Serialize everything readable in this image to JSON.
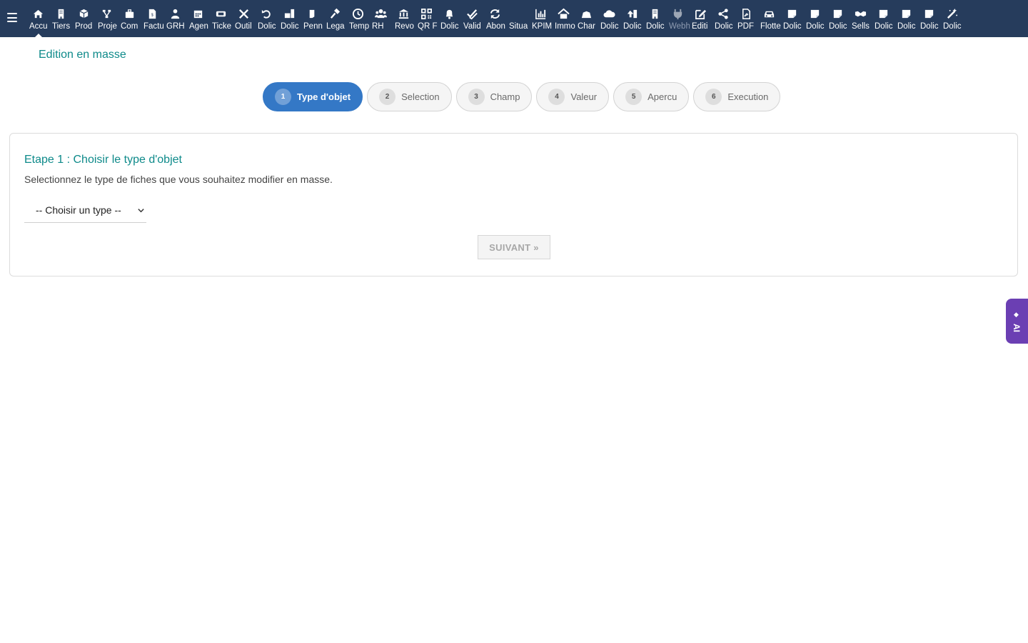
{
  "app": {
    "menu_icon": "hamburger-icon"
  },
  "top_menu": [
    {
      "label": "Accu",
      "icon": "home-icon",
      "active": true
    },
    {
      "label": "Tiers",
      "icon": "building-icon"
    },
    {
      "label": "Prod",
      "icon": "cube-icon"
    },
    {
      "label": "Proje",
      "icon": "sitemap-icon"
    },
    {
      "label": "Com",
      "icon": "suitcase-icon"
    },
    {
      "label": "Factu",
      "icon": "invoice-icon"
    },
    {
      "label": "GRH",
      "icon": "user-tie-icon"
    },
    {
      "label": "Agen",
      "icon": "calendar-icon"
    },
    {
      "label": "Ticke",
      "icon": "ticket-icon"
    },
    {
      "label": "Outil",
      "icon": "tools-icon"
    },
    {
      "label": "Dolic",
      "icon": "undo-icon"
    },
    {
      "label": "Dolic",
      "icon": "briefcase-doc-icon"
    },
    {
      "label": "Penn",
      "icon": "page-icon"
    },
    {
      "label": "Lega",
      "icon": "gavel-icon"
    },
    {
      "label": "Temp",
      "icon": "clock-icon"
    },
    {
      "label": "RH",
      "icon": "users-icon"
    },
    {
      "label": "Revo",
      "icon": "bank-icon"
    },
    {
      "label": "QR F",
      "icon": "qrcode-icon"
    },
    {
      "label": "Dolic",
      "icon": "bell-icon"
    },
    {
      "label": "Valid",
      "icon": "double-check-icon"
    },
    {
      "label": "Abon",
      "icon": "refresh-icon"
    },
    {
      "label": "Situa",
      "icon": "blank-icon"
    },
    {
      "label": "KPIM",
      "icon": "bar-chart-icon"
    },
    {
      "label": "Immo",
      "icon": "house-icon"
    },
    {
      "label": "Char",
      "icon": "pile-icon"
    },
    {
      "label": "Dolic",
      "icon": "cloud-icon"
    },
    {
      "label": "Dolic",
      "icon": "upload-icon"
    },
    {
      "label": "Dolic",
      "icon": "building-icon"
    },
    {
      "label": "Webh",
      "icon": "plug-icon",
      "dim": true
    },
    {
      "label": "Editi",
      "icon": "edit-icon"
    },
    {
      "label": "Dolic",
      "icon": "share-icon"
    },
    {
      "label": "PDF",
      "icon": "pdf-icon"
    },
    {
      "label": "Flotte",
      "icon": "car-icon"
    },
    {
      "label": "Dolic",
      "icon": "note-icon"
    },
    {
      "label": "Dolic",
      "icon": "note-icon"
    },
    {
      "label": "Dolic",
      "icon": "note-icon"
    },
    {
      "label": "Sells",
      "icon": "handshake-icon"
    },
    {
      "label": "Dolic",
      "icon": "note-icon"
    },
    {
      "label": "Dolic",
      "icon": "note-icon"
    },
    {
      "label": "Dolic",
      "icon": "note-icon"
    },
    {
      "label": "Dolic",
      "icon": "magic-icon"
    }
  ],
  "page": {
    "title": "Edition en masse"
  },
  "steps": [
    {
      "number": "1",
      "label": "Type d'objet",
      "active": true
    },
    {
      "number": "2",
      "label": "Selection"
    },
    {
      "number": "3",
      "label": "Champ"
    },
    {
      "number": "4",
      "label": "Valeur"
    },
    {
      "number": "5",
      "label": "Apercu"
    },
    {
      "number": "6",
      "label": "Execution"
    }
  ],
  "card": {
    "title": "Etape 1 : Choisir le type d'objet",
    "description": "Selectionnez le type de fiches que vous souhaitez modifier en masse.",
    "select_value": "-- Choisir un type --",
    "next_label": "SUIVANT »"
  },
  "ai_tab": {
    "label": "AI",
    "icon": "sparkle-icon"
  },
  "colors": {
    "topbar": "#263c5c",
    "accent_teal": "#0e8a8a",
    "step_active": "#3478c6",
    "ai_tab": "#6b3fb3"
  }
}
